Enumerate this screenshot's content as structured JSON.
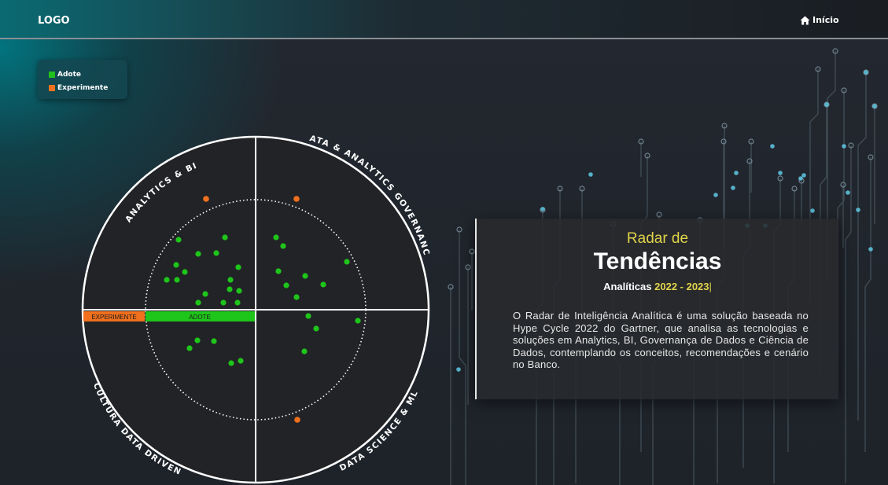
{
  "header": {
    "logo": "LOGO",
    "home_label": "Início"
  },
  "legend": {
    "items": [
      {
        "label": "Adote",
        "color": "#22c21e"
      },
      {
        "label": "Experimente",
        "color": "#f0701e"
      }
    ]
  },
  "radar": {
    "quadrants": [
      "ANALYTICS & BI",
      "DATA & ANALYTICS GOVERNANCE",
      "DATA SCIENCE & ML",
      "CULTURA DATA DRIVEN"
    ],
    "ring_labels": {
      "experiment": "EXPERIMENTE",
      "adopt": "ADOTE"
    },
    "colors": {
      "adopt": "#1ec51a",
      "experiment": "#f0701e"
    },
    "counts": {
      "adopt": 36,
      "experiment": 3
    }
  },
  "info": {
    "subtitle": "Radar de",
    "title": "Tendências",
    "years_prefix": "Analíticas",
    "years": "2022 - 2023",
    "description": "O Radar de Inteligência Analítica é uma solução baseada no Hype Cycle 2022 do Gartner, que analisa as tecnologias e soluções em Analytics, BI, Governança de Dados e Ciência de Dados, contemplando os conceitos, recomendações e cenário no Banco."
  }
}
